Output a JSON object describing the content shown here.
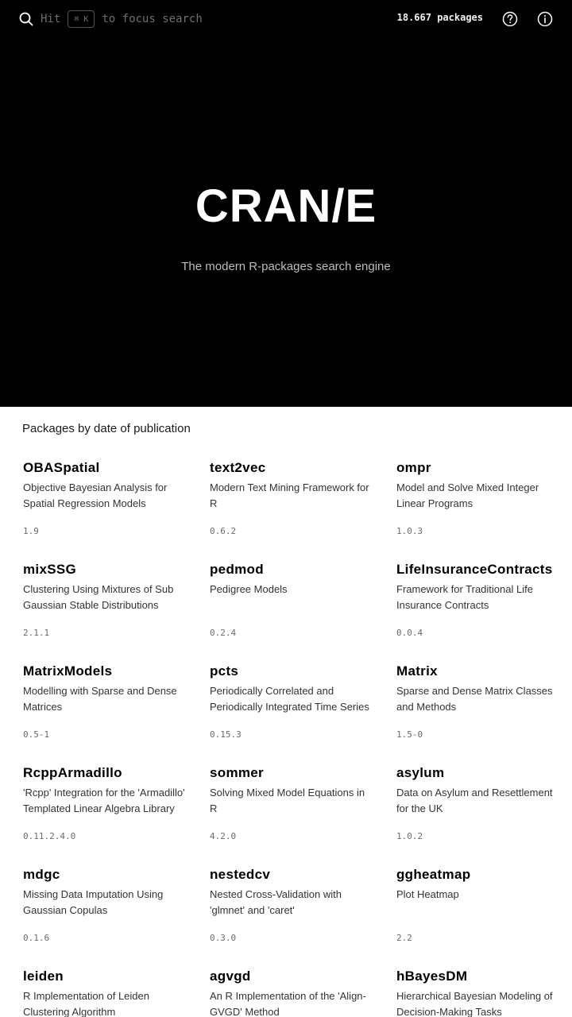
{
  "header": {
    "search_hint_prefix": "Hit",
    "search_hint_key": "⌘ K",
    "search_hint_suffix": "to focus search",
    "package_count": "18.667 packages",
    "icons": [
      "search-icon",
      "help-icon",
      "info-icon"
    ]
  },
  "hero": {
    "logo": "CRAN/E",
    "tagline": "The modern R-packages search engine"
  },
  "list": {
    "title": "Packages by date of publication",
    "packages": [
      {
        "name": "OBASpatial",
        "description": "Objective Bayesian Analysis for Spatial Regression Models",
        "version": "1.9"
      },
      {
        "name": "text2vec",
        "description": "Modern Text Mining Framework for R",
        "version": "0.6.2"
      },
      {
        "name": "ompr",
        "description": "Model and Solve Mixed Integer Linear Programs",
        "version": "1.0.3"
      },
      {
        "name": "mixSSG",
        "description": "Clustering Using Mixtures of Sub Gaussian Stable Distributions",
        "version": "2.1.1"
      },
      {
        "name": "pedmod",
        "description": "Pedigree Models",
        "version": "0.2.4"
      },
      {
        "name": "LifeInsuranceContracts",
        "description": "Framework for Traditional Life Insurance Contracts",
        "version": "0.0.4"
      },
      {
        "name": "MatrixModels",
        "description": "Modelling with Sparse and Dense Matrices",
        "version": "0.5-1"
      },
      {
        "name": "pcts",
        "description": "Periodically Correlated and Periodically Integrated Time Series",
        "version": "0.15.3"
      },
      {
        "name": "Matrix",
        "description": "Sparse and Dense Matrix Classes and Methods",
        "version": "1.5-0"
      },
      {
        "name": "RcppArmadillo",
        "description": "'Rcpp' Integration for the 'Armadillo' Templated Linear Algebra Library",
        "version": "0.11.2.4.0"
      },
      {
        "name": "sommer",
        "description": "Solving Mixed Model Equations in R",
        "version": "4.2.0"
      },
      {
        "name": "asylum",
        "description": "Data on Asylum and Resettlement for the UK",
        "version": "1.0.2"
      },
      {
        "name": "mdgc",
        "description": "Missing Data Imputation Using Gaussian Copulas",
        "version": "0.1.6"
      },
      {
        "name": "nestedcv",
        "description": "Nested Cross-Validation with 'glmnet' and 'caret'",
        "version": "0.3.0"
      },
      {
        "name": "ggheatmap",
        "description": "Plot Heatmap",
        "version": "2.2"
      },
      {
        "name": "leiden",
        "description": "R Implementation of Leiden Clustering Algorithm",
        "version": ""
      },
      {
        "name": "agvgd",
        "description": "An R Implementation of the 'Align-GVGD' Method",
        "version": ""
      },
      {
        "name": "hBayesDM",
        "description": "Hierarchical Bayesian Modeling of Decision-Making Tasks",
        "version": ""
      }
    ]
  }
}
